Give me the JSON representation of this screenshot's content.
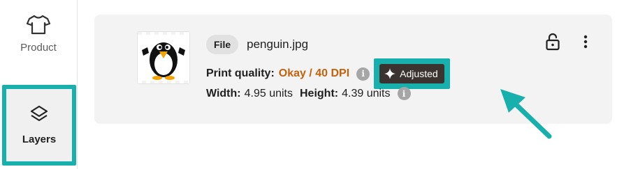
{
  "sidebar": {
    "items": [
      {
        "label": "Product",
        "icon": "tshirt-icon"
      },
      {
        "label": "Layers",
        "icon": "layers-icon",
        "selected": true
      }
    ]
  },
  "layer": {
    "file_badge": "File",
    "file_name": "penguin.jpg",
    "print_quality_label": "Print quality:",
    "print_quality_value": "Okay / 40 DPI",
    "adjusted_label": "Adjusted",
    "width_label": "Width:",
    "width_value": "4.95 units",
    "height_label": "Height:",
    "height_value": "4.39 units",
    "info_glyph": "i"
  },
  "colors": {
    "highlight": "#17b0ac",
    "quality_warning": "#c4620c",
    "adjusted_bg": "#3a3330",
    "card_bg": "#f3f3f3"
  }
}
